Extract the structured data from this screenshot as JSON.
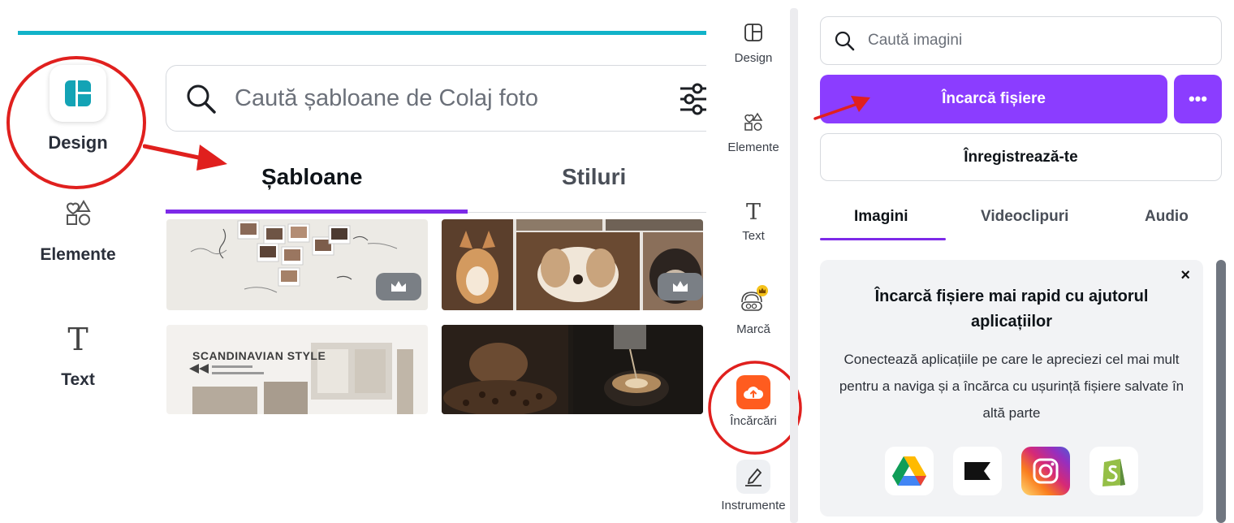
{
  "left_panel": {
    "sidebar": {
      "design_label": "Design",
      "elements_label": "Elemente",
      "text_label": "Text"
    },
    "search": {
      "placeholder": "Caută șabloane de Colaj foto"
    },
    "tabs": [
      {
        "label": "Șabloane",
        "active": true
      },
      {
        "label": "Stiluri",
        "active": false
      }
    ],
    "thumbnails": {
      "scandinavian_title": "SCANDINAVIAN STYLE"
    }
  },
  "mid_sidebar": {
    "items": [
      {
        "label": "Design",
        "icon": "layout-icon"
      },
      {
        "label": "Elemente",
        "icon": "shapes-icon"
      },
      {
        "label": "Text",
        "icon": "text-icon"
      },
      {
        "label": "Marcă",
        "icon": "brand-icon"
      },
      {
        "label": "Încărcări",
        "icon": "cloud-upload-icon",
        "active": true
      },
      {
        "label": "Instrumente",
        "icon": "draw-icon"
      }
    ]
  },
  "right_panel": {
    "search": {
      "placeholder": "Caută imagini"
    },
    "upload_button": "Încarcă fișiere",
    "more_button": "•••",
    "signup_button": "Înregistrează-te",
    "tabs": [
      {
        "label": "Imagini",
        "active": true
      },
      {
        "label": "Videoclipuri",
        "active": false
      },
      {
        "label": "Audio",
        "active": false
      }
    ],
    "promo": {
      "title": "Încarcă fișiere mai rapid cu ajutorul aplicațiilor",
      "description": "Conectează aplicațiile pe care le apreciezi cel mai mult pentru a naviga și a încărca cu ușurință fișiere salvate în altă parte",
      "close": "×",
      "apps": [
        "google-drive-icon",
        "dropbox-icon",
        "instagram-icon",
        "shopify-icon"
      ]
    }
  },
  "colors": {
    "accent_purple": "#8b3dff",
    "tab_underline": "#7d2ae8",
    "annotation_red": "#e0201e",
    "upload_orange": "#ff5c1f",
    "teal_bar": "#12b3c9"
  }
}
